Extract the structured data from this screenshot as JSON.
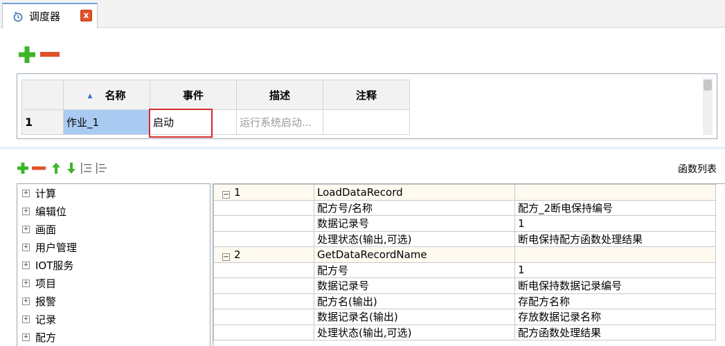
{
  "tab": {
    "title": "调度器",
    "icon": "scheduler-icon",
    "close_icon": "close-icon",
    "close_label": "x"
  },
  "top_toolbar": {
    "add_icon": "plus-icon",
    "remove_icon": "minus-icon"
  },
  "job_grid": {
    "columns": [
      "名称",
      "事件",
      "描述",
      "注释"
    ],
    "sort_icon": "sort-up-icon",
    "rows": [
      {
        "num": "1",
        "name": "作业_1",
        "event": "启动",
        "desc": "运行系统启动...",
        "note": ""
      }
    ]
  },
  "fn_toolbar": {
    "icons": [
      "plus-icon",
      "minus-icon",
      "arrow-up-icon",
      "arrow-down-icon",
      "indent-icon",
      "outdent-icon"
    ],
    "function_list_label": "函数列表"
  },
  "tree": {
    "items": [
      "计算",
      "编辑位",
      "画面",
      "用户管理",
      "IOT服务",
      "项目",
      "报警",
      "记录",
      "配方"
    ],
    "expander": "⊞"
  },
  "functions": [
    {
      "index": "1",
      "name": "LoadDataRecord",
      "expander": "⊟",
      "params": [
        {
          "label": "配方号/名称",
          "value": "配方_2断电保持编号"
        },
        {
          "label": "数据记录号",
          "value": "1"
        },
        {
          "label": "处理状态(输出,可选)",
          "value": "断电保持配方函数处理结果"
        }
      ]
    },
    {
      "index": "2",
      "name": "GetDataRecordName",
      "expander": "⊟",
      "params": [
        {
          "label": "配方号",
          "value": "1"
        },
        {
          "label": "数据记录号",
          "value": "断电保持数据记录编号"
        },
        {
          "label": "配方名(输出)",
          "value": "存配方名称"
        },
        {
          "label": "数据记录名(输出)",
          "value": "存放数据记录名称"
        },
        {
          "label": "处理状态(输出,可选)",
          "value": "配方函数处理结果"
        }
      ]
    }
  ],
  "colors": {
    "accent": "#3b78c4",
    "add_green": "#3cb528",
    "remove_red": "#e0522b",
    "highlight_red": "#d42a2a",
    "selected_blue": "#a9cbf2"
  }
}
